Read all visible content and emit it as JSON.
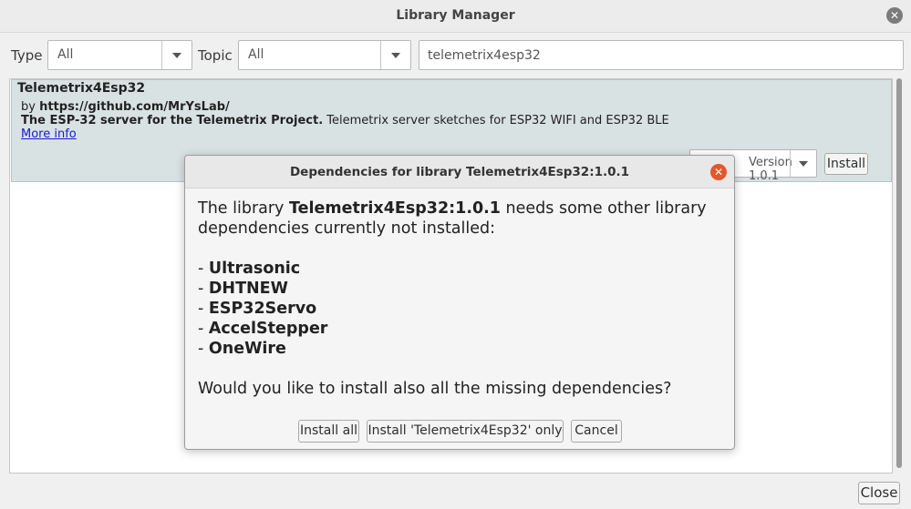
{
  "window": {
    "title": "Library Manager",
    "close_glyph": "✕"
  },
  "filters": {
    "type_label": "Type",
    "type_value": "All",
    "topic_label": "Topic",
    "topic_value": "All",
    "search_value": "telemetrix4esp32"
  },
  "library": {
    "name": "Telemetrix4Esp32",
    "by_prefix": "by ",
    "author_url": "https://github.com/MrYsLab/",
    "desc_bold": "The ESP-32 server for the Telemetrix Project.",
    "desc_rest": " Telemetrix server sketches for ESP32 WIFI and ESP32 BLE",
    "more_info": "More info",
    "version_label": "Version 1.0.1",
    "install_label": "Install"
  },
  "dialog": {
    "title": "Dependencies for library Telemetrix4Esp32:1.0.1",
    "close_glyph": "✕",
    "msg_prefix": "The library ",
    "msg_library": "Telemetrix4Esp32:1.0.1",
    "msg_suffix": " needs some other library dependencies currently not installed:",
    "dependencies": [
      "Ultrasonic",
      "DHTNEW",
      "ESP32Servo",
      "AccelStepper",
      "OneWire"
    ],
    "dash": "- ",
    "question": "Would you like to install also all the missing dependencies?",
    "install_all_label": "Install all",
    "install_only_label": "Install 'Telemetrix4Esp32' only",
    "cancel_label": "Cancel"
  },
  "footer": {
    "close_label": "Close"
  }
}
